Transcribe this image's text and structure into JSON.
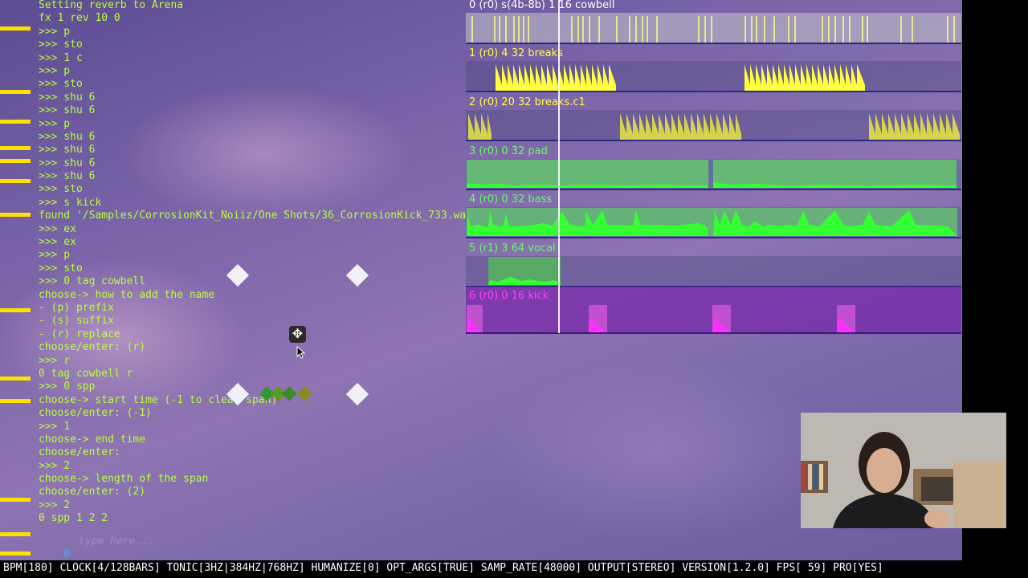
{
  "console": {
    "lines": [
      "Setting reverb to Arena",
      "fx 1 rev 10 0",
      ">>> p",
      ">>> sto",
      ">>> 1 c",
      ">>> p",
      ">>> sto",
      ">>> shu 6",
      ">>> shu 6",
      ">>> p",
      ">>> shu 6",
      ">>> shu 6",
      ">>> shu 6",
      ">>> shu 6",
      ">>> sto",
      ">>> s kick",
      "found '/Samples/CorrosionKit_Noiiz/One Shots/36_CorrosionKick_733.wav'",
      ">>> ex",
      ">>> ex",
      ">>> p",
      ">>> sto",
      ">>> 0 tag cowbell",
      "choose-> how to add the name",
      "- (p) prefix",
      "- (s) suffix",
      "- (r) replace",
      "choose/enter: (r)",
      ">>> r",
      "0 tag cowbell r",
      ">>> 0 spp",
      "choose-> start time (-1 to clear span)",
      "choose/enter: (-1)",
      ">>> 1",
      "choose-> end time",
      "choose/enter:",
      ">>> 2",
      "choose-> length of the span",
      "choose/enter: (2)",
      ">>> 2",
      "0 spp 1 2 2"
    ],
    "input": {
      "prompt": "0",
      "placeholder": "type here..."
    }
  },
  "tracks": [
    {
      "label": "0 (r0) s(4b-8b) 1 16 cowbell",
      "color": "#ffffff"
    },
    {
      "label": "1 (r0) 4 32 breaks",
      "color": "#ffff40"
    },
    {
      "label": "2 (r0) 20 32 breaks.c1",
      "color": "#ffff40"
    },
    {
      "label": "3 (r0) 0 32 pad",
      "color": "#66ff66"
    },
    {
      "label": "4 (r0) 0 32 bass",
      "color": "#66ff66"
    },
    {
      "label": "5 (r1) 3 64 vocal",
      "color": "#66ff66"
    },
    {
      "label": "6 (r0) 0 16 kick",
      "color": "#ff40ff"
    }
  ],
  "overlay": {
    "move_icon": "✥"
  },
  "statusbar": {
    "text": "BPM[180] CLOCK[4/128BARS] TONIC[3HZ|384HZ|768HZ] HUMANIZE[0] OPT_ARGS[TRUE] SAMP_RATE[48000] OUTPUT[STEREO] VERSION[1.2.0] FPS[ 59] PRO[YES]"
  },
  "colors": {
    "console_text": "#b8ff3c",
    "marker": "#ffe000",
    "prompt": "#3db3ff",
    "breaks_fill": "#ffff40",
    "green_fill": "#33ff33",
    "kick_fill": "#ff30ff"
  }
}
